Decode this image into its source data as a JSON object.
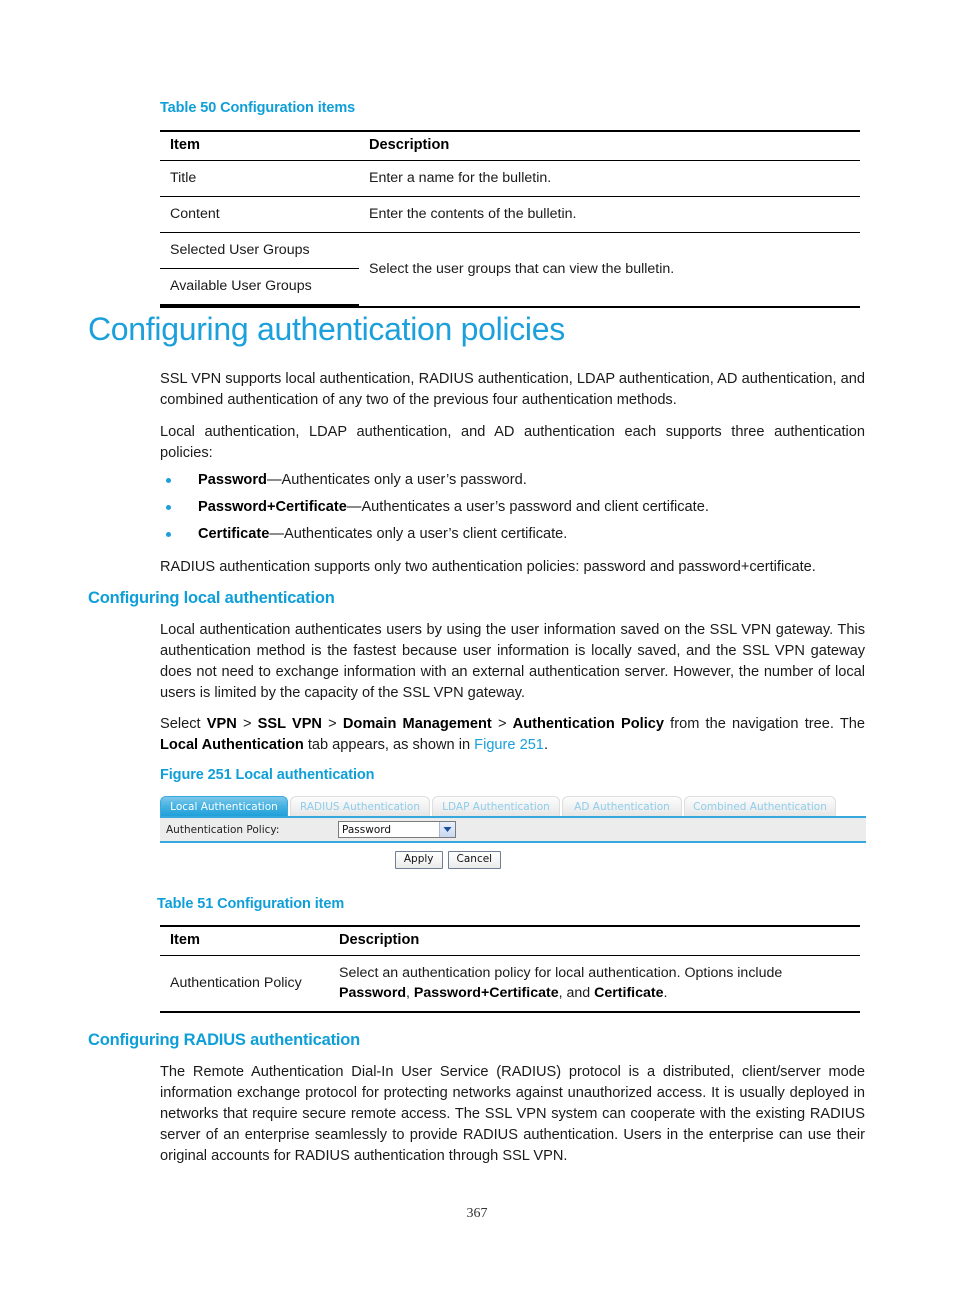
{
  "page": {
    "number": "367"
  },
  "table50": {
    "caption": "Table 50 Configuration items",
    "headers": [
      "Item",
      "Description"
    ],
    "rows": [
      {
        "item": "Title",
        "description": "Enter a name for the bulletin."
      },
      {
        "item": "Content",
        "description": "Enter the contents of the bulletin."
      },
      {
        "item": "Selected User Groups",
        "description": "Select the user groups that can view the bulletin."
      },
      {
        "item": "Available User Groups",
        "description": ""
      }
    ]
  },
  "section_auth_policies": {
    "heading": "Configuring authentication policies",
    "para1": "SSL VPN supports local authentication, RADIUS authentication, LDAP authentication, AD authentication, and combined authentication of any two of the previous four authentication methods.",
    "para2": "Local authentication, LDAP authentication, and AD authentication each supports three authentication policies:",
    "bullets": [
      {
        "term": "Password",
        "rest": "—Authenticates only a user’s password."
      },
      {
        "term": "Password+Certificate",
        "rest": "—Authenticates a user’s password and client certificate."
      },
      {
        "term": "Certificate",
        "rest": "—Authenticates only a user’s client certificate."
      }
    ],
    "para3": "RADIUS authentication supports only two authentication policies: password and password+certificate."
  },
  "section_local_auth": {
    "heading": "Configuring local authentication",
    "para1": "Local authentication authenticates users by using the user information saved on the SSL VPN gateway. This authentication method is the fastest because user information is locally saved, and the SSL VPN gateway does not need to exchange information with an external authentication server. However, the number of local users is limited by the capacity of the SSL VPN gateway.",
    "nav_prefix": "Select ",
    "nav_path": [
      "VPN",
      "SSL VPN",
      "Domain Management",
      "Authentication Policy"
    ],
    "nav_separator": " > ",
    "nav_suffix": " from the navigation tree. The ",
    "tab_name": "Local Authentication",
    "nav_tail": " tab appears, as shown in ",
    "xref": "Figure 251",
    "nav_end": "."
  },
  "figure251": {
    "caption": "Figure 251 Local authentication",
    "tabs": [
      {
        "label": "Local Authentication",
        "active": true
      },
      {
        "label": "RADIUS Authentication",
        "active": false
      },
      {
        "label": "LDAP Authentication",
        "active": false
      },
      {
        "label": "AD Authentication",
        "active": false
      },
      {
        "label": "Combined Authentication",
        "active": false
      }
    ],
    "form": {
      "label": "Authentication Policy:",
      "select_value": "Password",
      "select_icon": "chevron-down-icon"
    },
    "buttons": [
      {
        "label": "Apply"
      },
      {
        "label": "Cancel"
      }
    ]
  },
  "table51": {
    "caption": "Table 51 Configuration item",
    "headers": [
      "Item",
      "Description"
    ],
    "row": {
      "item": "Authentication Policy",
      "desc_part1": "Select an authentication policy for local authentication. Options include ",
      "desc_bold1": "Password",
      "desc_part2": ", ",
      "desc_bold2": "Password+Certificate",
      "desc_part3": ", and ",
      "desc_bold3": "Certificate",
      "desc_part4": "."
    }
  },
  "section_radius_auth": {
    "heading": "Configuring RADIUS authentication",
    "para1": "The Remote Authentication Dial-In User Service (RADIUS) protocol is a distributed, client/server mode information exchange protocol for protecting networks against unauthorized access. It is usually deployed in networks that require secure remote access. The SSL VPN system can cooperate with the existing RADIUS server of an enterprise seamlessly to provide RADIUS authentication. Users in the enterprise can use their original accounts for RADIUS authentication through SSL VPN."
  },
  "colors": {
    "heading_blue": "#1ba0db",
    "caption_blue": "#0f9fd8",
    "panel_border": "#35a9de",
    "tab_active_blue": "#49b3e2"
  }
}
